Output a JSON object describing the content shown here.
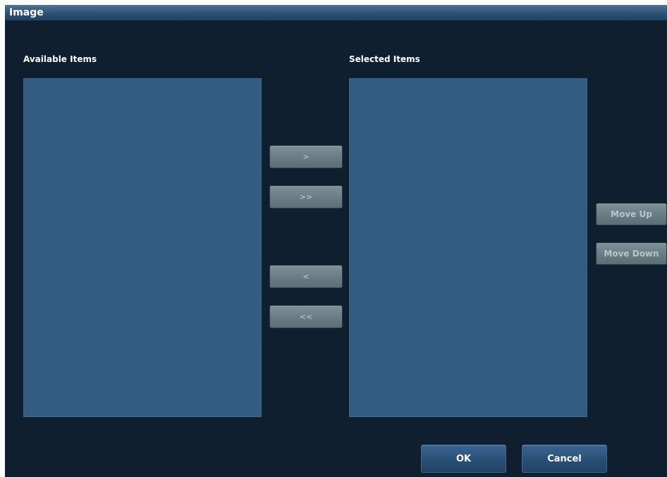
{
  "window": {
    "title": "Image"
  },
  "available": {
    "label": "Available Items",
    "items": []
  },
  "selected": {
    "label": "Selected Items",
    "items": []
  },
  "transfer_buttons": {
    "add": ">",
    "add_all": ">>",
    "remove": "<",
    "remove_all": "<<"
  },
  "order_buttons": {
    "move_up": "Move Up",
    "move_down": "Move Down"
  },
  "footer": {
    "ok": "OK",
    "cancel": "Cancel"
  }
}
